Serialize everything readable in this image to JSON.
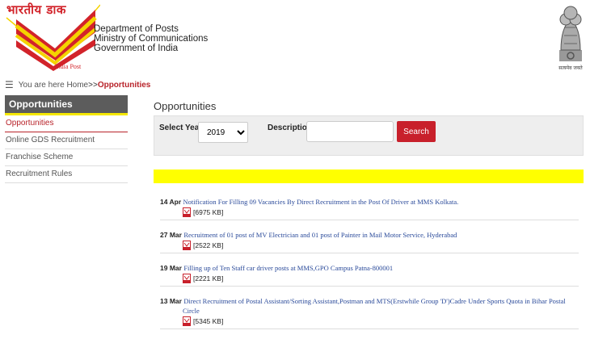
{
  "header": {
    "logo_hindi": "भारतीय डाक",
    "logo_caption": "India Post",
    "department_lines": [
      "Department of Posts",
      "Ministry of Communications",
      "Government of India"
    ],
    "emblem_motto": "सत्यमेव जयते"
  },
  "breadcrumb": {
    "prefix": "You are here Home",
    "separator": ">>",
    "current": "Opportunities"
  },
  "sidebar": {
    "heading": "Opportunities",
    "items": [
      {
        "label": "Opportunities",
        "active": true
      },
      {
        "label": "Online GDS Recruitment"
      },
      {
        "label": "Franchise Scheme"
      },
      {
        "label": "Recruitment Rules"
      }
    ]
  },
  "main": {
    "title": "Opportunities",
    "filter": {
      "year_label": "Select Year",
      "year_value": "2019",
      "description_label": "Description",
      "description_value": "",
      "search_label": "Search"
    }
  },
  "notices": [
    {
      "date": "14 Apr",
      "title": "Notification For Filling 09 Vacancies By Direct Recruitment in the Post Of Driver at MMS Kolkata.",
      "title_cont": "",
      "size": "[6975 KB]"
    },
    {
      "date": "27 Mar",
      "title": "Recruitment of 01 post of MV Electrician and 01 post of Painter in Mail Motor Service, Hyderabad",
      "title_cont": "",
      "size": "[2522 KB]"
    },
    {
      "date": "19 Mar",
      "title": "Filling up of Ten Staff car driver posts at MMS,GPO Campus Patna-800001",
      "title_cont": "",
      "size": "[2221 KB]"
    },
    {
      "date": "13 Mar",
      "title": "Direct Recruitment of Postal Assistant/Sorting Assistant,Postman and MTS(Erstwhile Group 'D')Cadre Under Sports Quota in Bihar Postal",
      "title_cont": "Circle",
      "size": "[5345 KB]"
    }
  ],
  "colors": {
    "accent_red": "#c8202b",
    "highlight_yellow": "#ffff00",
    "link_blue": "#2a4a9a"
  }
}
